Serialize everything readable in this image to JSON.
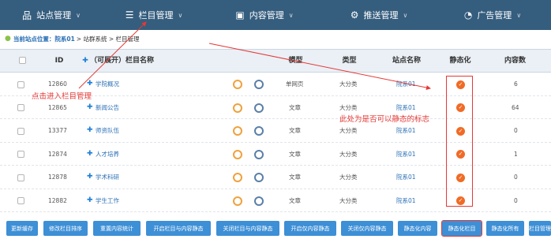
{
  "nav": {
    "items": [
      {
        "label": "站点管理",
        "icon": "sitemap-icon",
        "glyph": "品"
      },
      {
        "label": "栏目管理",
        "icon": "list-icon",
        "glyph": "☰"
      },
      {
        "label": "内容管理",
        "icon": "document-icon",
        "glyph": "▣"
      },
      {
        "label": "推送管理",
        "icon": "sliders-icon",
        "glyph": "⚙"
      },
      {
        "label": "广告管理",
        "icon": "megaphone-icon",
        "glyph": "◔"
      }
    ],
    "chevron": "∨"
  },
  "breadcrumb": {
    "prefix": "当前站点位置：院系01",
    "path": "> 站群系统 > 栏目管理"
  },
  "table": {
    "headers": {
      "id": "ID",
      "name": "（可展开）栏目名称",
      "template": "模型",
      "type": "类型",
      "site": "站点名称",
      "static": "静态化",
      "count": "内容数"
    },
    "rows": [
      {
        "id": "12860",
        "name": "学院概况",
        "template": "单网页",
        "type": "大分类",
        "site": "院系01",
        "count": "6"
      },
      {
        "id": "12865",
        "name": "新闻公告",
        "template": "文章",
        "type": "大分类",
        "site": "院系01",
        "count": "64"
      },
      {
        "id": "13377",
        "name": "师资队伍",
        "template": "文章",
        "type": "大分类",
        "site": "院系01",
        "count": "0"
      },
      {
        "id": "12874",
        "name": "人才培养",
        "template": "文章",
        "type": "大分类",
        "site": "院系01",
        "count": "1"
      },
      {
        "id": "12878",
        "name": "学术科研",
        "template": "文章",
        "type": "大分类",
        "site": "院系01",
        "count": "0"
      },
      {
        "id": "12882",
        "name": "学生工作",
        "template": "文章",
        "type": "大分类",
        "site": "院系01",
        "count": "0"
      }
    ]
  },
  "annotations": {
    "click_hint": "点击进入栏目管理",
    "static_hint": "此处为是否可以静态的标志"
  },
  "buttons": [
    "更新缓存",
    "修改栏目排序",
    "重置内容统计",
    "开启栏目与内容静态",
    "关闭栏目与内容静态",
    "开启仅内容静态",
    "关闭仅内容静态",
    "静态化内容",
    "静态化栏目",
    "静态化所有",
    "栏目管理"
  ],
  "colors": {
    "nav_bg": "#355d7e",
    "accent": "#3d8fd6",
    "annotation": "#e53935",
    "check": "#f06b26"
  }
}
